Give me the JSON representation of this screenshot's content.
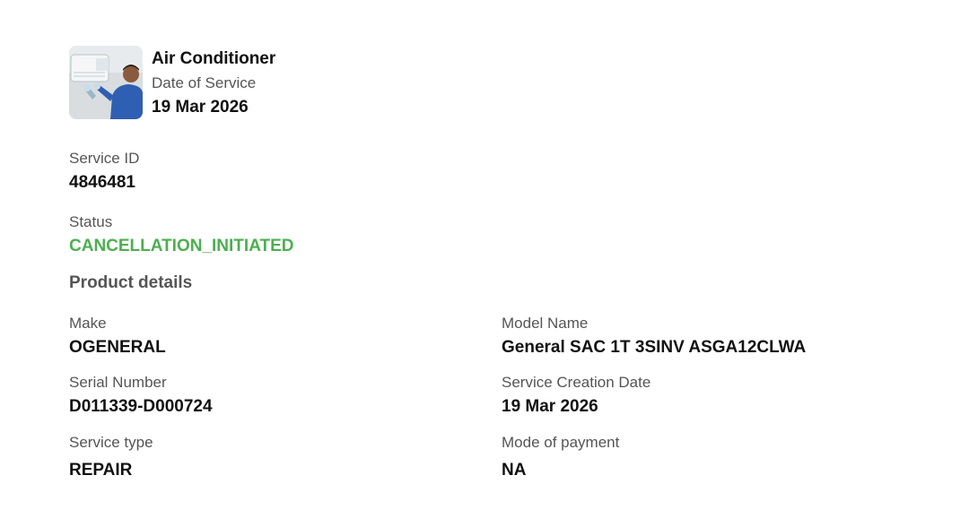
{
  "header": {
    "product_name": "Air Conditioner",
    "date_label": "Date of Service",
    "date_value": "19 Mar 2026"
  },
  "service_id": {
    "label": "Service ID",
    "value": "4846481"
  },
  "status": {
    "label": "Status",
    "value": "CANCELLATION_INITIATED",
    "color": "#4caf50"
  },
  "product_details": {
    "title": "Product details",
    "make": {
      "label": "Make",
      "value": "OGENERAL"
    },
    "model_name": {
      "label": "Model Name",
      "value": "General SAC 1T 3SINV ASGA12CLWA"
    },
    "serial_number": {
      "label": "Serial Number",
      "value": "D011339-D000724"
    },
    "service_creation_date": {
      "label": "Service Creation Date",
      "value": "19 Mar 2026"
    },
    "service_type": {
      "label": "Service type",
      "value": "REPAIR"
    },
    "mode_of_payment": {
      "label": "Mode of payment",
      "value": "NA"
    }
  },
  "icons": {
    "thumbnail": "technician-servicing-ac-image"
  }
}
